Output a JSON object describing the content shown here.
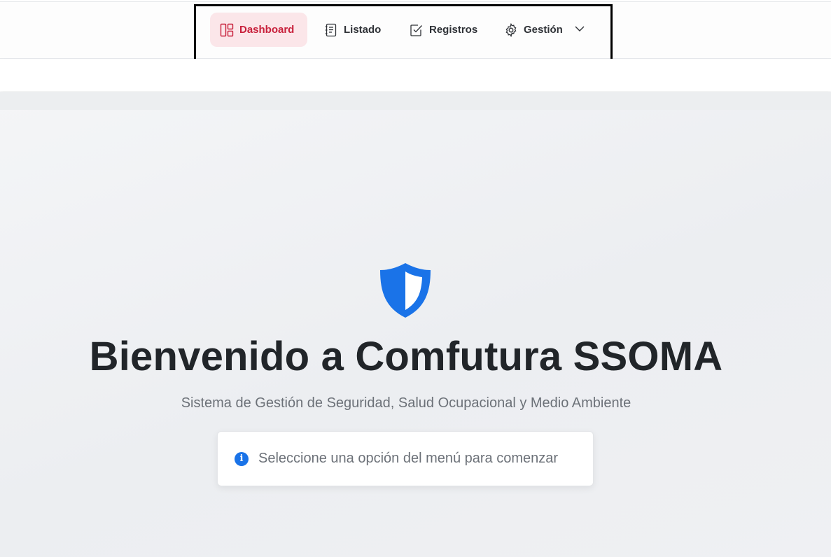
{
  "nav": {
    "items": [
      {
        "label": "Dashboard",
        "icon": "dashboard-layout-icon",
        "active": true
      },
      {
        "label": "Listado",
        "icon": "list-document-icon",
        "active": false
      },
      {
        "label": "Registros",
        "icon": "checkbox-icon",
        "active": false
      },
      {
        "label": "Gestión",
        "icon": "gear-icon",
        "active": false,
        "dropdown": true
      }
    ]
  },
  "hero": {
    "icon": "shield-icon",
    "title": "Bienvenido a Comfutura SSOMA",
    "subtitle": "Sistema de Gestión de Seguridad, Salud Ocupacional y Medio Ambiente"
  },
  "info": {
    "icon": "info-circle-icon",
    "text": "Seleccione una opción del menú para comenzar"
  },
  "colors": {
    "accent_active": "#c8203b",
    "active_bg": "#fbe6e9",
    "primary_blue": "#1a73e8",
    "title_text": "#212529",
    "muted_text": "#6c7178"
  }
}
